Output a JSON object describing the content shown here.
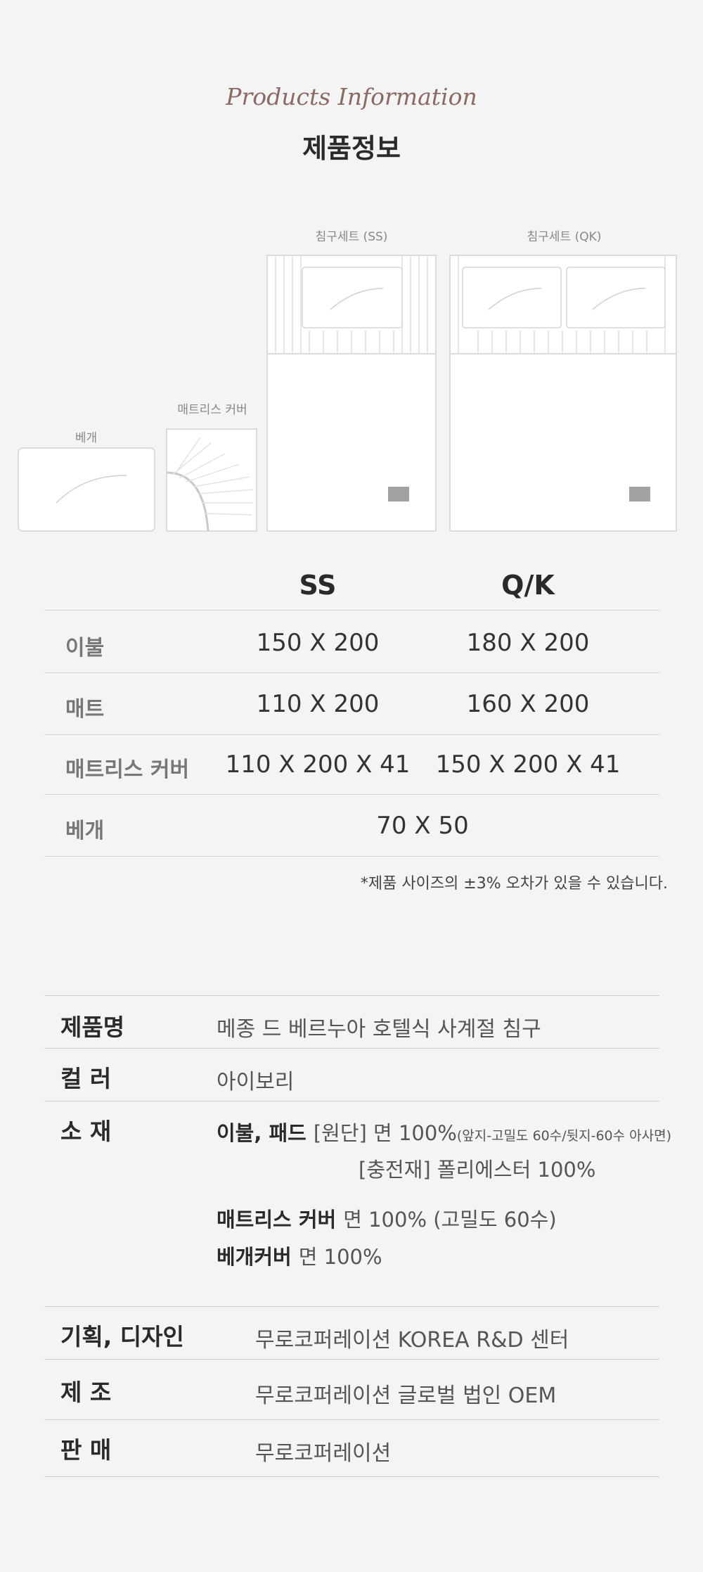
{
  "header": {
    "title_en": "Products Information",
    "title_ko": "제품정보"
  },
  "illustration": {
    "pillow_label": "베개",
    "mattress_cover_label": "매트리스 커버",
    "ss_set_label": "침구세트 (SS)",
    "qk_set_label": "침구세트 (QK)"
  },
  "size_table": {
    "columns": [
      "SS",
      "Q/K"
    ],
    "rows": [
      {
        "label": "이불",
        "ss": "150 X 200",
        "qk": "180 X 200"
      },
      {
        "label": "매트",
        "ss": "110 X 200",
        "qk": "160 X 200"
      },
      {
        "label": "매트리스 커버",
        "ss": "110 X 200 X 41",
        "qk": "150 X 200 X 41"
      },
      {
        "label": "베개",
        "both": "70 X 50"
      }
    ],
    "note": "*제품 사이즈의 ±3% 오차가 있을 수 있습니다."
  },
  "info_table": {
    "product_name_label": "제품명",
    "product_name": "메종 드 베르누아 호텔식 사계절 침구",
    "color_label": "컬 러",
    "color": "아이보리",
    "material_label": "소 재",
    "material": {
      "duvet_pad_title": "이불, 패드",
      "duvet_fabric": "[원단] 면 100%",
      "duvet_fabric_detail": "(앞지-고밀도 60수/뒷지-60수 아사면)",
      "duvet_filling": "[충전재] 폴리에스터 100%",
      "mattress_cover_title": "매트리스 커버",
      "mattress_cover_value": "면 100% (고밀도 60수)",
      "pillow_cover_title": "베개커버",
      "pillow_cover_value": "면 100%"
    },
    "design_label": "기획, 디자인",
    "design": "무로코퍼레이션 KOREA R&D 센터",
    "manufacture_label": "제 조",
    "manufacture": "무로코퍼레이션 글로벌 법인 OEM",
    "sales_label": "판 매",
    "sales": "무로코퍼레이션"
  }
}
